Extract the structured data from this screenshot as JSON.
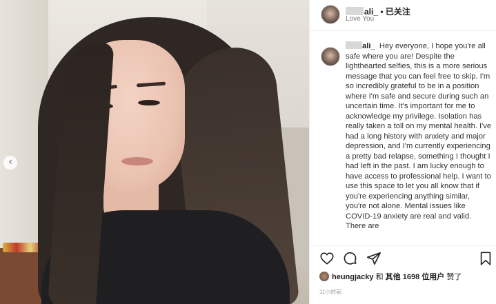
{
  "header": {
    "username": "ali_",
    "separator": "•",
    "follow_status": "已关注",
    "subtitle": "Love You"
  },
  "caption": {
    "username": "ali_",
    "text": "Hey everyone, I hope you're all safe where you are! Despite the lighthearted selfies, this is a more serious message that you can feel free to skip. I'm so incredibly grateful to be in a position where I'm safe and secure during such an uncertain time. It's important for me to acknowledge my privilege. Isolation has really taken a toll on my mental health. I've had a long history with anxiety and major depression, and I'm currently experiencing a pretty bad relapse, something I thought I had left in the past. I am lucky enough to have access to professional help. I want to use this space to let you all know that if you're experiencing anything similar, you're not alone. Mental issues like COVID-19 anxiety are real and valid. There are"
  },
  "actions": {
    "like_icon": "heart-icon",
    "comment_icon": "comment-icon",
    "share_icon": "share-icon",
    "save_icon": "bookmark-icon"
  },
  "likes": {
    "user": "heungjacky",
    "connector": "和",
    "others_prefix": "其他",
    "count": "1698",
    "others_suffix": "位用户",
    "verb": "赞了"
  },
  "timestamp": "11小时前",
  "carousel": {
    "prev_icon": "chevron-left-icon",
    "prev_glyph": "‹"
  }
}
